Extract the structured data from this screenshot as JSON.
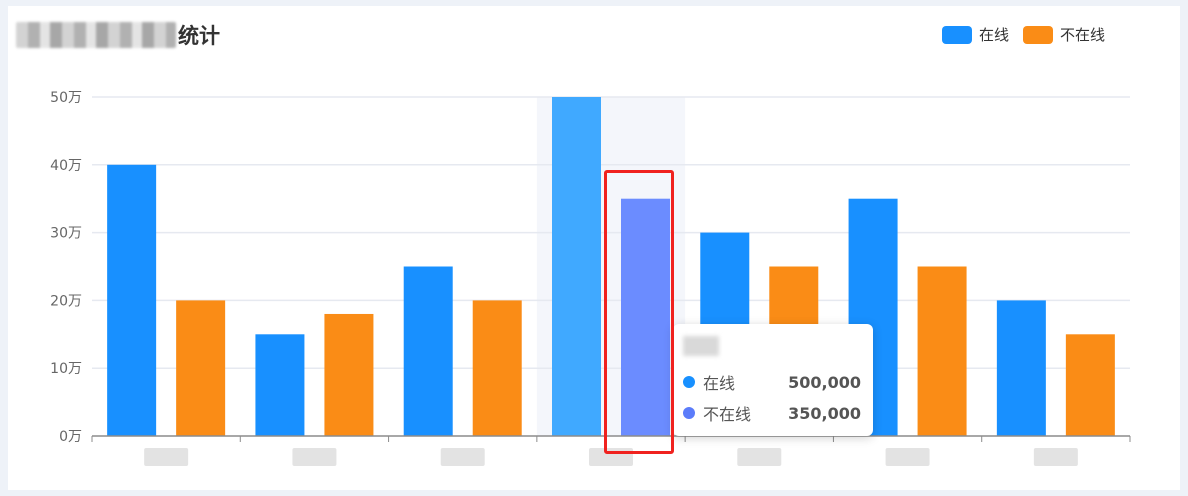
{
  "title": "统计",
  "colors": {
    "online": "#1890ff",
    "offline": "#fa8c16",
    "offline_hover": "#6b8cff",
    "online_hover": "#40a9ff"
  },
  "legend": [
    {
      "label": "在线",
      "color": "#1890ff"
    },
    {
      "label": "不在线",
      "color": "#fa8c16"
    }
  ],
  "tooltip": {
    "rows": [
      {
        "label": "在线",
        "value": "500,000",
        "color": "#1890ff"
      },
      {
        "label": "不在线",
        "value": "350,000",
        "color": "#5b7cfa"
      }
    ]
  },
  "chart_data": {
    "type": "bar",
    "categories": [
      "",
      "",
      "",
      "",
      "",
      "",
      ""
    ],
    "series": [
      {
        "name": "在线",
        "values": [
          400000,
          150000,
          250000,
          500000,
          300000,
          350000,
          200000
        ]
      },
      {
        "name": "不在线",
        "values": [
          200000,
          180000,
          200000,
          350000,
          250000,
          250000,
          150000
        ]
      }
    ],
    "ylim": [
      0,
      500000
    ],
    "yticks": [
      "0万",
      "10万",
      "20万",
      "30万",
      "40万",
      "50万"
    ],
    "grid": true,
    "legend_position": "top-right",
    "highlighted_category_index": 3
  }
}
